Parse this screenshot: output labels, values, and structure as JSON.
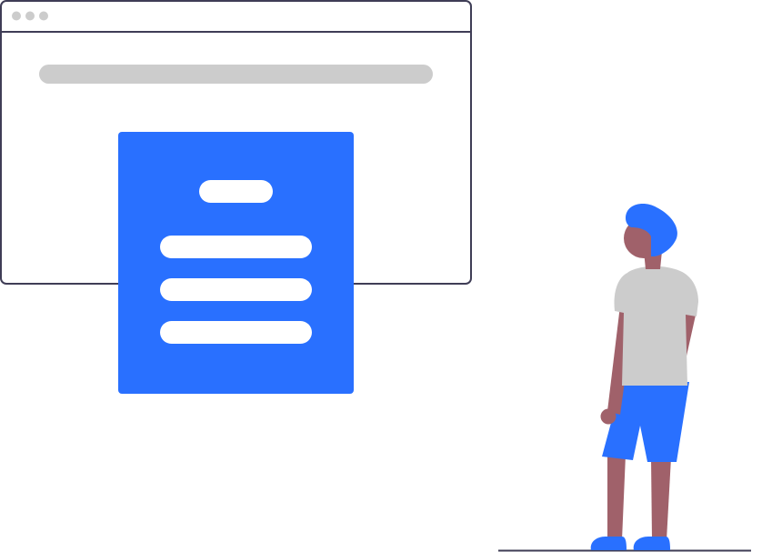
{
  "palette": {
    "accent": "#2970ff",
    "outline": "#3f3d56",
    "placeholder": "#cccccc",
    "background": "#ffffff",
    "skin": "#a0616a",
    "shirt": "#cccccc",
    "hair": "#2970ff",
    "shorts": "#2970ff",
    "shoes": "#2970ff"
  },
  "browser_window": {
    "dots": 3
  },
  "document_card": {
    "text_lines": 3
  }
}
